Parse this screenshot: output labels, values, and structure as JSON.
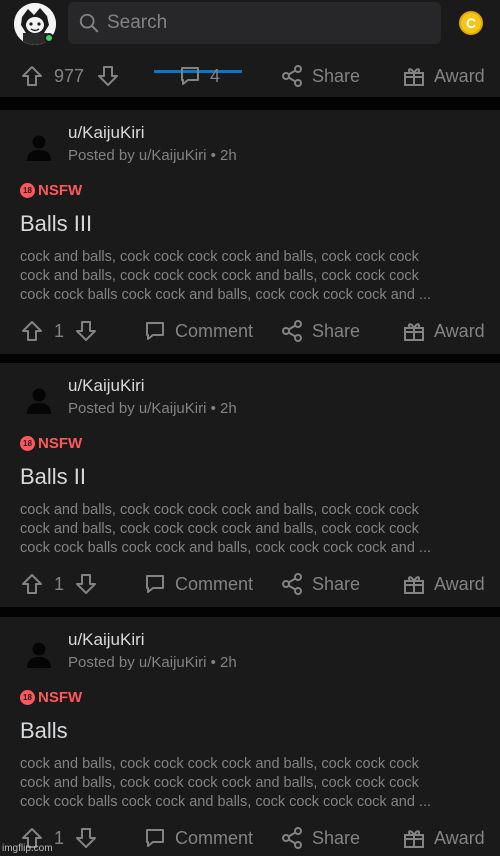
{
  "header": {
    "search_placeholder": "Search",
    "coin_label": "C"
  },
  "previous_post": {
    "votes": "977",
    "comments": "4",
    "share_label": "Share",
    "award_label": "Award"
  },
  "posts": [
    {
      "username": "u/KaijuKiri",
      "posted_by": "Posted by u/KaijuKiri",
      "age": "2h",
      "nsfw_label": "NSFW",
      "nsfw_badge": "18",
      "title": "Balls III",
      "body_lines": [
        "cock and balls, cock cock cock cock and balls, cock cock cock",
        "cock and balls, cock cock cock cock and balls, cock cock cock",
        "cock cock balls cock cock and balls, cock cock cock cock and ..."
      ],
      "votes": "1",
      "comment_label": "Comment",
      "share_label": "Share",
      "award_label": "Award"
    },
    {
      "username": "u/KaijuKiri",
      "posted_by": "Posted by u/KaijuKiri",
      "age": "2h",
      "nsfw_label": "NSFW",
      "nsfw_badge": "18",
      "title": "Balls II",
      "body_lines": [
        "cock and balls, cock cock cock cock and balls, cock cock cock",
        "cock and balls, cock cock cock cock and balls, cock cock cock",
        "cock cock balls cock cock and balls, cock cock cock cock and ..."
      ],
      "votes": "1",
      "comment_label": "Comment",
      "share_label": "Share",
      "award_label": "Award"
    },
    {
      "username": "u/KaijuKiri",
      "posted_by": "Posted by u/KaijuKiri",
      "age": "2h",
      "nsfw_label": "NSFW",
      "nsfw_badge": "18",
      "title": "Balls",
      "body_lines": [
        "cock and balls, cock cock cock cock and balls, cock cock cock",
        "cock and balls, cock cock cock cock and balls, cock cock cock",
        "cock cock balls cock cock and balls, cock cock cock cock and ..."
      ],
      "votes": "1",
      "comment_label": "Comment",
      "share_label": "Share",
      "award_label": "Award"
    }
  ],
  "watermark": "imgflip.com",
  "colors": {
    "background": "#030303",
    "card": "#1a1a1b",
    "text": "#d7dadc",
    "muted": "#818384",
    "nsfw": "#ff585b",
    "accent": "#0079d3",
    "coin": "#f5c518"
  }
}
